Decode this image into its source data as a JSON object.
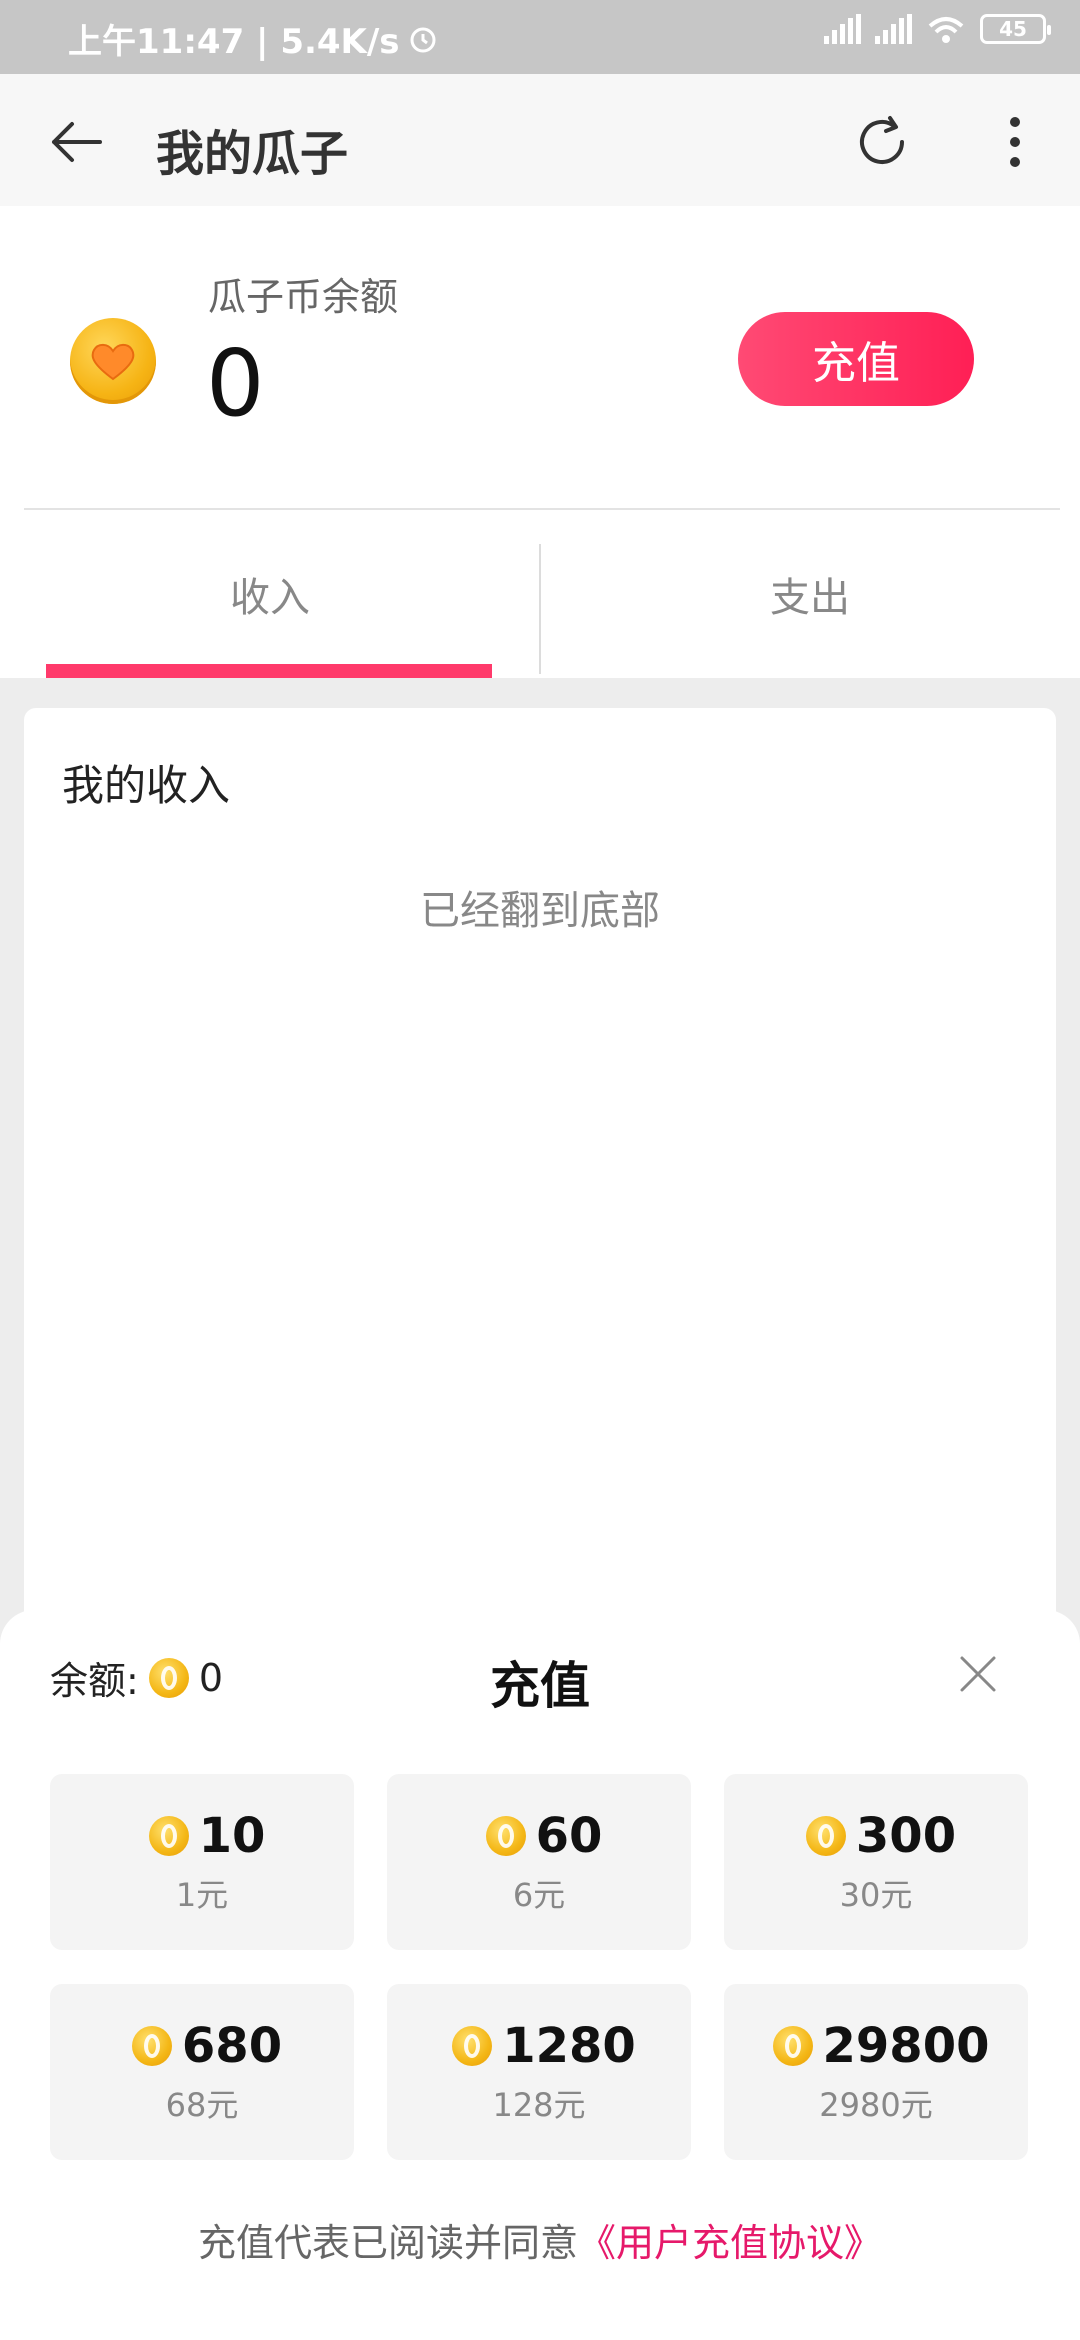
{
  "status_bar": {
    "time_speed": "上午11:47 | 5.4K/s",
    "battery": "45"
  },
  "header": {
    "title": "我的瓜子"
  },
  "balance": {
    "label": "瓜子币余额",
    "amount": "0",
    "recharge_button": "充值"
  },
  "tabs": {
    "income": "收入",
    "expense": "支出",
    "active": "income"
  },
  "income_card": {
    "title": "我的收入",
    "bottom_message": "已经翻到底部"
  },
  "sheet": {
    "balance_label": "余额:",
    "balance_value": "0",
    "title": "充值",
    "packages": [
      {
        "coins": "10",
        "price": "1元"
      },
      {
        "coins": "60",
        "price": "6元"
      },
      {
        "coins": "300",
        "price": "30元"
      },
      {
        "coins": "680",
        "price": "68元"
      },
      {
        "coins": "1280",
        "price": "128元"
      },
      {
        "coins": "29800",
        "price": "2980元"
      }
    ],
    "agreement_prefix": "充值代表已阅读并同意",
    "agreement_link": "《用户充值协议》"
  },
  "colors": {
    "accent": "#ff2d5e",
    "link": "#e6196a",
    "coin": "#f6b415"
  }
}
